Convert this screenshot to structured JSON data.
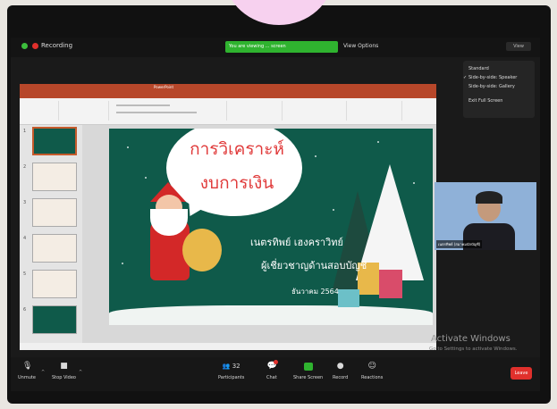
{
  "meeting": {
    "recording_label": "Recording",
    "share_banner_text": "You are viewing ... screen",
    "view_options_label": "View Options",
    "view_button_label": "View",
    "view_menu": {
      "items": [
        {
          "label": "Standard",
          "checked": false
        },
        {
          "label": "Side-by-side: Speaker",
          "checked": true
        },
        {
          "label": "Side-by-side: Gallery",
          "checked": false
        },
        {
          "label": "Exit Full Screen",
          "checked": false
        }
      ]
    }
  },
  "powerpoint": {
    "window_title": "PowerPoint",
    "tabs": [
      "File",
      "Home",
      "Insert",
      "Draw",
      "Design",
      "Transitions",
      "Animations",
      "Slide Show",
      "Review",
      "View",
      "ACROBAT",
      "Tell me"
    ],
    "active_tab": "Home",
    "thumbnails": [
      "1",
      "2",
      "3",
      "4",
      "5",
      "6"
    ],
    "slide": {
      "title_line1": "การวิเคราะห์",
      "title_line2": "งบการเงิน",
      "presenter": "เนตรทิพย์  เฮงคราวิทย์",
      "role": "ผู้เชี่ยวชาญด้านสอบบัญชี",
      "date": "ธันวาคม 2564"
    }
  },
  "speaker_video": {
    "name_tag": "เนตรทิพย์ (สมาคมนักบัญชี)"
  },
  "windows_watermark": {
    "line1": "Activate Windows",
    "line2": "Go to Settings to activate Windows."
  },
  "toolbar": {
    "unmute_label": "Unmute",
    "stop_video_label": "Stop Video",
    "participants_label": "Participants",
    "participants_count": "32",
    "chat_label": "Chat",
    "share_screen_label": "Share Screen",
    "record_label": "Record",
    "reactions_label": "Reactions",
    "leave_label": "Leave"
  }
}
